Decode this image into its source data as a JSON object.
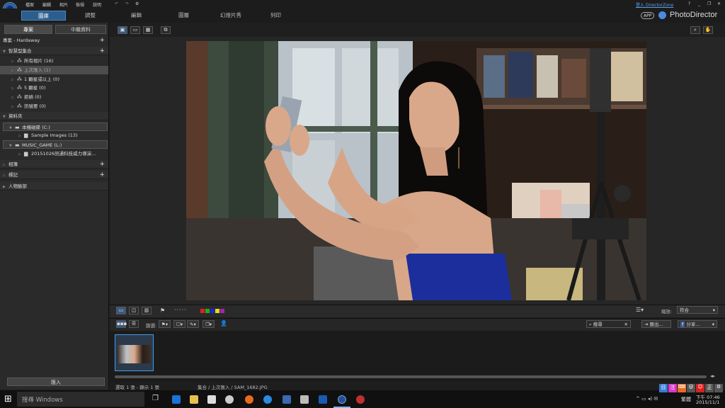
{
  "titlebar": {
    "menus": [
      "檔案",
      "編輯",
      "相片",
      "檢視",
      "說明"
    ],
    "login": "登入 DirectorZone",
    "help": "?"
  },
  "modes": {
    "tabs": [
      "圖庫",
      "調整",
      "編輯",
      "圖層",
      "幻燈片秀",
      "列印"
    ],
    "active": "圖庫"
  },
  "brand": {
    "app_badge": "APP",
    "name": "PhotoDirector"
  },
  "left_panel": {
    "tabs": [
      "專案",
      "中繼資料"
    ],
    "project_label": "專案 - Hardaway",
    "smart_collections_label": "智慧型集合",
    "smart_items": [
      "所有相片 (16)",
      "上次匯入 (1)",
      "1 顆星或以上 (0)",
      "5 顆星 (0)",
      "拒絕 (0)",
      "訊號要 (0)"
    ],
    "folders_label": "資料夾",
    "drive_c": "本機磁碟 (C:)",
    "sample_images": "Sample Images (13)",
    "drive_l": "MUSIC_GAME (L:)",
    "event_folder": "20151026訊通科技威力導演...",
    "albums_label": "相簿",
    "tags_label": "標記",
    "faces_label": "人物臉部",
    "import_button": "匯入"
  },
  "strip": {
    "zoom_label": "縮放:",
    "zoom_value": "符合",
    "filter_label": "篩選:",
    "search_placeholder": "搜尋",
    "export_button": "匯出...",
    "share_button": "分享..."
  },
  "status": {
    "left": "選取 1 張 - 顯示 1 張",
    "middle": "集合 / 上次匯入 / SAM_1682.JPG"
  },
  "taskbar": {
    "search_placeholder": "搜尋 Windows",
    "ime": "繁體",
    "time": "下午 07:46",
    "date": "2015/11/1"
  },
  "colors": {
    "accent": "#2c5d8c",
    "label_colors": [
      "#d22",
      "#2a2",
      "#22d",
      "#dd2",
      "#a2a"
    ]
  }
}
